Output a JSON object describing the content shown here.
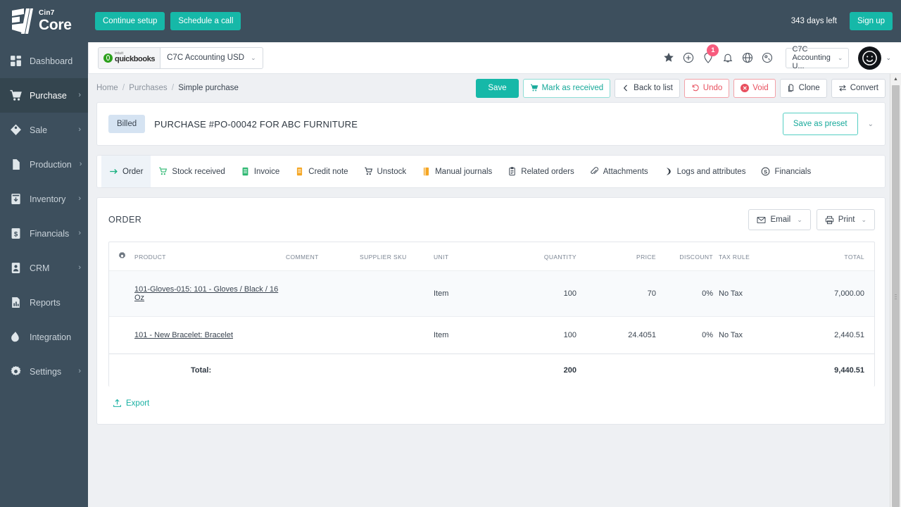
{
  "brand": {
    "cin7": "Cin7",
    "core": "Core"
  },
  "sidebar": {
    "items": [
      {
        "label": "Dashboard",
        "icon": "dashboard-icon",
        "chevron": "",
        "active": false
      },
      {
        "label": "Purchase",
        "icon": "cart-icon",
        "chevron": "›",
        "active": true
      },
      {
        "label": "Sale",
        "icon": "tag-icon",
        "chevron": "›",
        "active": false
      },
      {
        "label": "Production",
        "icon": "production-icon",
        "chevron": "›",
        "active": false
      },
      {
        "label": "Inventory",
        "icon": "inventory-box-icon",
        "chevron": "›",
        "active": false
      },
      {
        "label": "Financials",
        "icon": "dollar-note-icon",
        "chevron": "›",
        "active": false
      },
      {
        "label": "CRM",
        "icon": "contact-card-icon",
        "chevron": "›",
        "active": false
      },
      {
        "label": "Reports",
        "icon": "bar-chart-icon",
        "chevron": "",
        "active": false
      },
      {
        "label": "Integration",
        "icon": "integration-icon",
        "chevron": "",
        "active": false
      },
      {
        "label": "Settings",
        "icon": "gear-icon",
        "chevron": "›",
        "active": false
      }
    ]
  },
  "topbar": {
    "continue_setup": "Continue setup",
    "schedule_call": "Schedule a call",
    "days_left": "343 days left",
    "sign_up": "Sign up"
  },
  "subheader": {
    "connector": {
      "intuit": "intuit",
      "quickbooks": "quickbooks",
      "account": "C7C Accounting USD",
      "caret": "⌄"
    },
    "icons": [
      {
        "name": "star-icon"
      },
      {
        "name": "plus-circle-icon"
      },
      {
        "name": "location-pin-icon",
        "badge": "1"
      },
      {
        "name": "bell-icon"
      },
      {
        "name": "globe-icon"
      },
      {
        "name": "help-icon"
      }
    ],
    "org": {
      "value": "C7C Accounting U...",
      "caret": "⌄"
    },
    "avatar_caret": "⌄"
  },
  "breadcrumb": {
    "home": "Home",
    "section": "Purchases",
    "current": "Simple purchase",
    "separator": "/"
  },
  "actions": [
    {
      "label": "Save",
      "style": "save",
      "icon": ""
    },
    {
      "label": "Mark as received",
      "style": "teal-out",
      "icon": "cart-received-icon"
    },
    {
      "label": "Back to list",
      "style": "plain",
      "icon": "chevron-left-icon"
    },
    {
      "label": "Undo",
      "style": "red-out",
      "icon": "undo-icon"
    },
    {
      "label": "Void",
      "style": "red-out",
      "icon": "void-icon"
    },
    {
      "label": "Clone",
      "style": "plain",
      "icon": "clone-icon"
    },
    {
      "label": "Convert",
      "style": "plain",
      "icon": "convert-icon"
    }
  ],
  "title_card": {
    "status": "Billed",
    "title": "PURCHASE #PO-00042 FOR ABC FURNITURE",
    "save_as_preset": "Save as preset",
    "caret": "⌄"
  },
  "tabs": [
    {
      "label": "Order",
      "icon": "arrow-right-icon",
      "active": true
    },
    {
      "label": "Stock received",
      "icon": "stock-received-icon",
      "active": false
    },
    {
      "label": "Invoice",
      "icon": "invoice-icon",
      "active": false
    },
    {
      "label": "Credit note",
      "icon": "credit-note-icon",
      "active": false
    },
    {
      "label": "Unstock",
      "icon": "unstock-icon",
      "active": false
    },
    {
      "label": "Manual journals",
      "icon": "manual-journals-icon",
      "active": false
    },
    {
      "label": "Related orders",
      "icon": "related-orders-icon",
      "active": false
    },
    {
      "label": "Attachments",
      "icon": "paperclip-icon",
      "active": false
    },
    {
      "label": "Logs and attributes",
      "icon": "logs-icon",
      "active": false
    },
    {
      "label": "Financials",
      "icon": "financials-icon",
      "active": false
    }
  ],
  "order": {
    "heading": "ORDER",
    "email_button": "Email",
    "print_button": "Print",
    "caret": "⌄",
    "columns": [
      "PRODUCT",
      "COMMENT",
      "SUPPLIER SKU",
      "UNIT",
      "QUANTITY",
      "PRICE",
      "DISCOUNT",
      "TAX RULE",
      "TOTAL"
    ],
    "rows": [
      {
        "product": "101-Gloves-015: 101 - Gloves / Black / 16 Oz",
        "comment": "",
        "supplier_sku": "",
        "unit": "Item",
        "quantity": "100",
        "price": "70",
        "discount": "0%",
        "tax_rule": "No Tax",
        "total": "7,000.00"
      },
      {
        "product": "101 - New Bracelet: Bracelet",
        "comment": "",
        "supplier_sku": "",
        "unit": "Item",
        "quantity": "100",
        "price": "24.4051",
        "discount": "0%",
        "tax_rule": "No Tax",
        "total": "2,440.51"
      }
    ],
    "totals": {
      "label": "Total:",
      "quantity": "200",
      "total": "9,440.51"
    },
    "export": "Export"
  }
}
